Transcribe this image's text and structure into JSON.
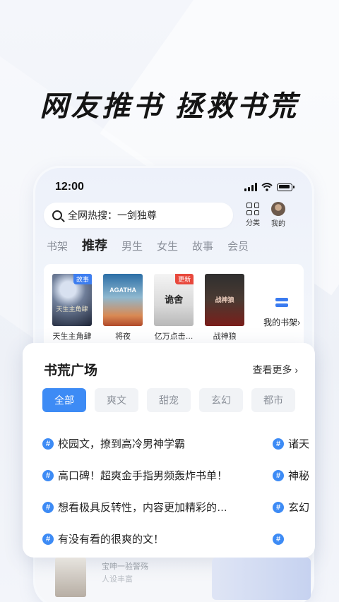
{
  "headline": "网友推书 拯救书荒",
  "status": {
    "time": "12:00"
  },
  "search": {
    "text": "全网热搜：一剑独尊"
  },
  "nav": {
    "category_label": "分类",
    "mine_label": "我的"
  },
  "tabs": [
    "书架",
    "推荐",
    "男生",
    "女生",
    "故事",
    "会员"
  ],
  "active_tab_index": 1,
  "shelf": {
    "books": [
      {
        "title": "天生主角肆",
        "badge": "故事",
        "badge_color": "#3d7ef0",
        "cover_text": "天生主角肆"
      },
      {
        "title": "将夜",
        "badge": "",
        "badge_color": "",
        "cover_text": "AGATHA"
      },
      {
        "title": "亿万点击…",
        "badge": "更新",
        "badge_color": "#e8483c",
        "cover_text": "诡舍"
      },
      {
        "title": "战神狼",
        "badge": "",
        "badge_color": "",
        "cover_text": "战神狼"
      }
    ],
    "my_shelf_label": "我的书架›"
  },
  "card": {
    "title": "书荒广场",
    "more": "查看更多 ›",
    "chips": [
      "全部",
      "爽文",
      "甜宠",
      "玄幻",
      "都市"
    ],
    "active_chip_index": 0,
    "topics": [
      {
        "text": "校园文，撩到高冷男神学霸",
        "side": "诸天"
      },
      {
        "text": "高口碑！超爽金手指男频轰炸书单！",
        "side": "神秘"
      },
      {
        "text": "想看极具反转性，内容更加精彩的…",
        "side": "玄幻"
      },
      {
        "text": "有没有看的很爽的文！",
        "side": ""
      }
    ]
  },
  "peek": {
    "line1": "宝呻一验警殇",
    "line2": "人设丰富"
  },
  "colors": {
    "accent": "#3d8bf5"
  }
}
